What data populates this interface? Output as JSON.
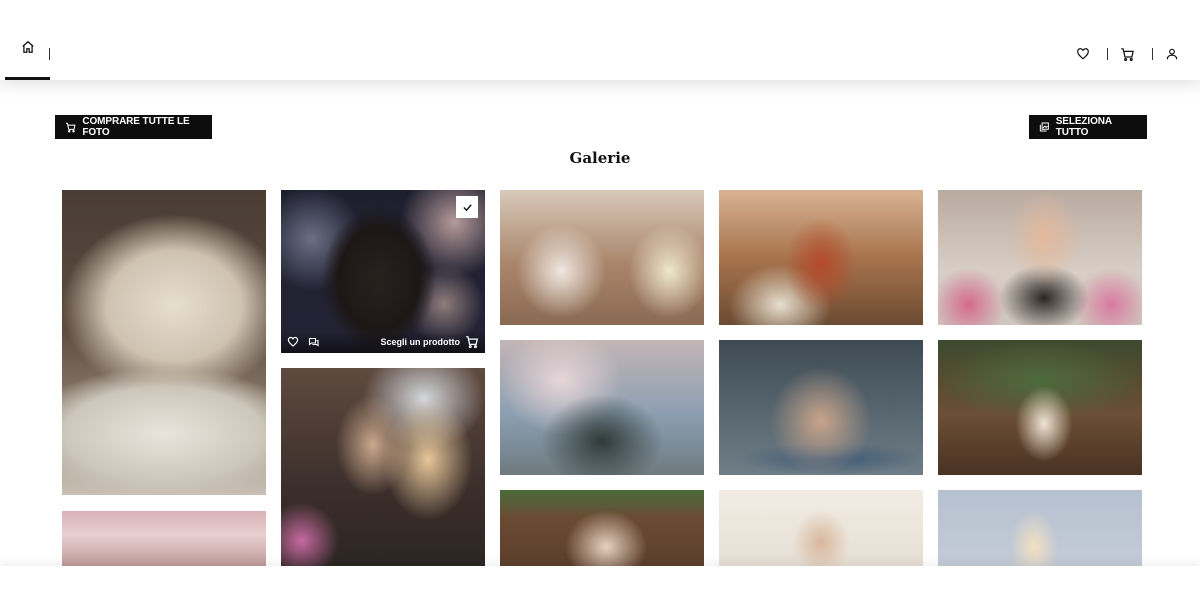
{
  "nav": {
    "home_icon": "home-icon",
    "right_icons": [
      "heart-icon",
      "cart-icon",
      "user-icon"
    ]
  },
  "toolbar": {
    "buy_all_label": "COMPRARE TUTTE LE FOTO",
    "select_all_label": "SELEZIONA TUTTO"
  },
  "gallery": {
    "title": "Galerie",
    "choose_product_label": "Scegli un prodotto"
  },
  "colors": {
    "button_bg": "#0d0d0d",
    "text": "#111111"
  }
}
